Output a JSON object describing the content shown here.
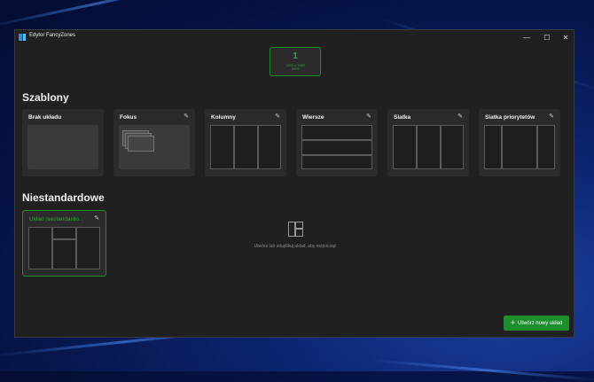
{
  "window": {
    "title": "Edytor FancyZones",
    "controls": {
      "minimize": "—",
      "maximize": "☐",
      "close": "✕"
    }
  },
  "monitor": {
    "number": "1",
    "resolution": "1920 x 1080",
    "scale": "100%"
  },
  "sections": {
    "templates": "Szablony",
    "custom": "Niestandardowe"
  },
  "templates": [
    {
      "label": "Brak układu",
      "editable": false
    },
    {
      "label": "Fokus",
      "editable": true
    },
    {
      "label": "Kolumny",
      "editable": true
    },
    {
      "label": "Wiersze",
      "editable": true
    },
    {
      "label": "Siatka",
      "editable": true
    },
    {
      "label": "Siatka priorytetów",
      "editable": true
    }
  ],
  "custom_layouts": [
    {
      "label": "Układ niestandardo..."
    }
  ],
  "empty_state": {
    "text": "Utwórz lub zduplikuj układ, aby rozpocząć"
  },
  "buttons": {
    "new_layout_icon": "+",
    "new_layout": "Utwórz nowy układ"
  },
  "icons": {
    "edit": "✎"
  },
  "colors": {
    "accent": "#1a8f2a",
    "accent_text": "#2ea83b",
    "card_bg": "#2b2b2b",
    "window_bg": "#202020"
  }
}
